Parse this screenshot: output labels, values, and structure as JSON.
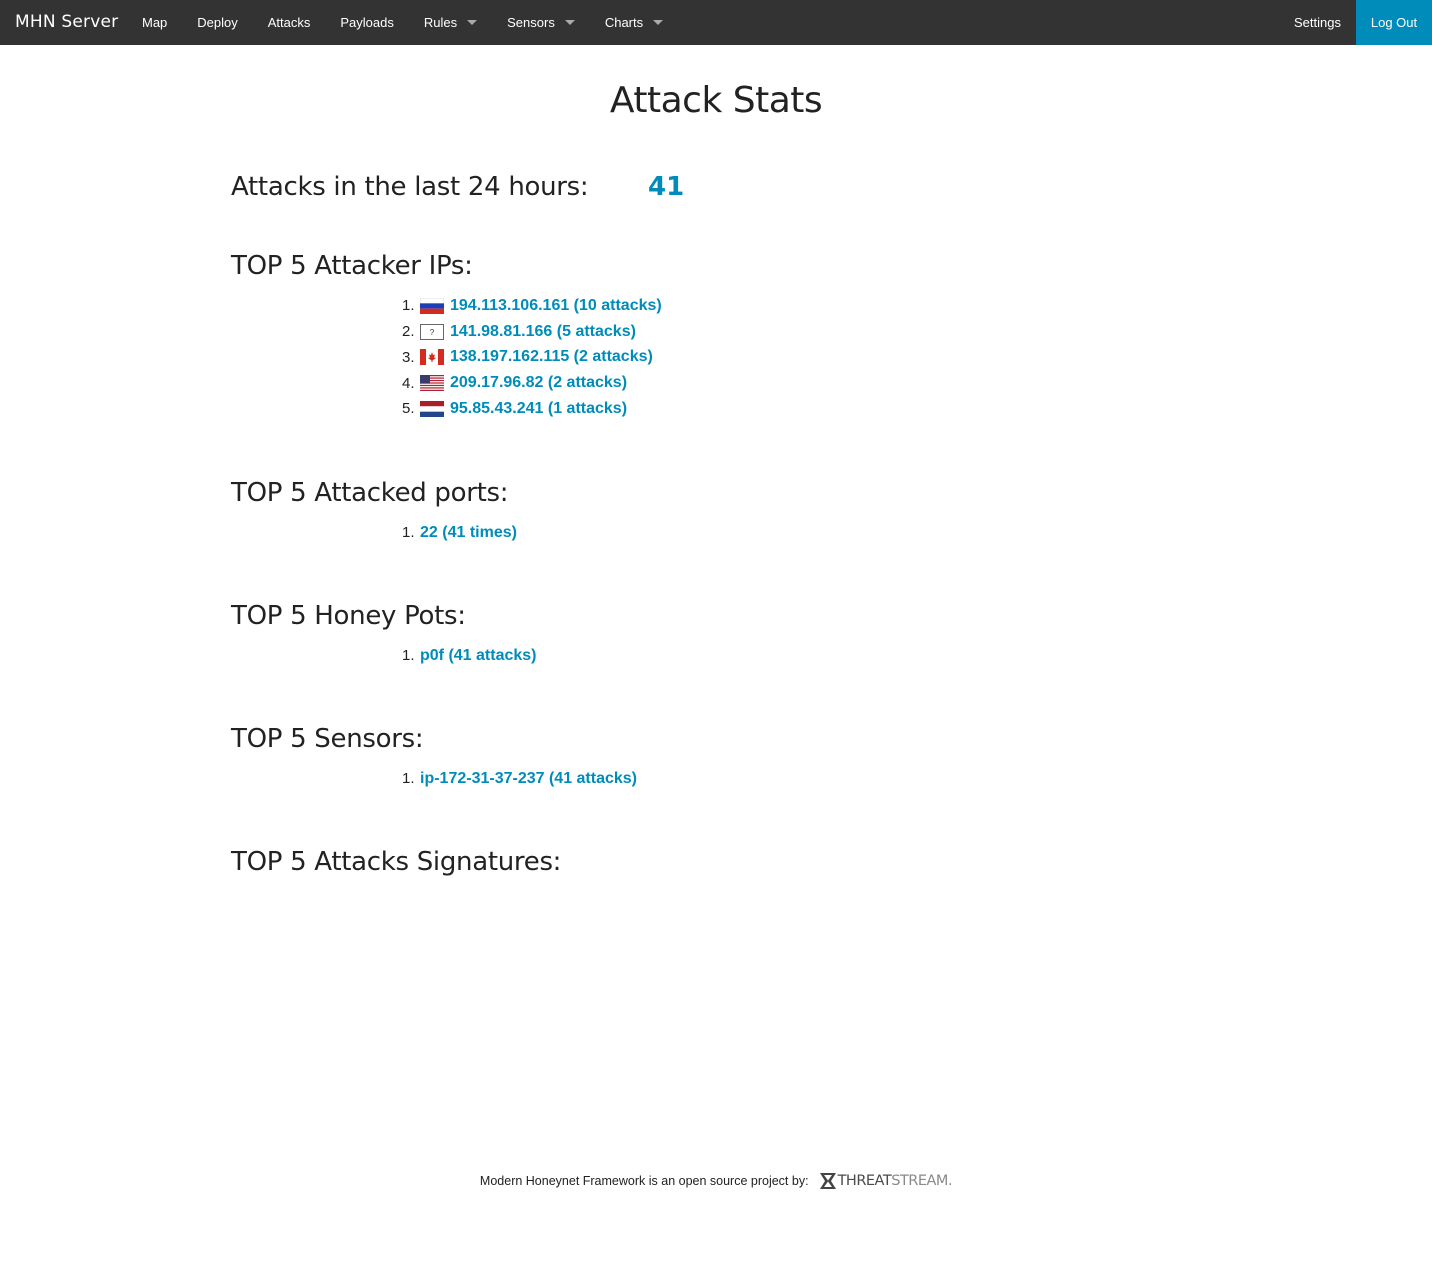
{
  "navbar": {
    "brand": "MHN Server",
    "items": [
      {
        "label": "Map",
        "dropdown": false
      },
      {
        "label": "Deploy",
        "dropdown": false
      },
      {
        "label": "Attacks",
        "dropdown": false
      },
      {
        "label": "Payloads",
        "dropdown": false
      },
      {
        "label": "Rules",
        "dropdown": true
      },
      {
        "label": "Sensors",
        "dropdown": true
      },
      {
        "label": "Charts",
        "dropdown": true
      }
    ],
    "settings": "Settings",
    "logout": "Log Out",
    "accent_color": "#008cba",
    "background_color": "#333333"
  },
  "main": {
    "title": "Attack Stats",
    "attacks_24h": {
      "label": "Attacks in the last 24 hours:",
      "value": "41"
    },
    "top_ips": {
      "heading": "TOP 5 Attacker IPs:",
      "items": [
        {
          "rank": "1.",
          "flag": "russia-flag-icon",
          "text": "194.113.106.161 (10 attacks)"
        },
        {
          "rank": "2.",
          "flag": "unknown-flag-icon",
          "text": "141.98.81.166 (5 attacks)"
        },
        {
          "rank": "3.",
          "flag": "canada-flag-icon",
          "text": "138.197.162.115 (2 attacks)"
        },
        {
          "rank": "4.",
          "flag": "usa-flag-icon",
          "text": "209.17.96.82 (2 attacks)"
        },
        {
          "rank": "5.",
          "flag": "netherlands-flag-icon",
          "text": "95.85.43.241 (1 attacks)"
        }
      ]
    },
    "top_ports": {
      "heading": "TOP 5 Attacked ports:",
      "items": [
        {
          "rank": "1.",
          "text": "22 (41 times)"
        }
      ]
    },
    "top_honeypots": {
      "heading": "TOP 5 Honey Pots:",
      "items": [
        {
          "rank": "1.",
          "text": "p0f (41 attacks)"
        }
      ]
    },
    "top_sensors": {
      "heading": "TOP 5 Sensors:",
      "items": [
        {
          "rank": "1.",
          "text": "ip-172-31-37-237 (41 attacks)"
        }
      ]
    },
    "top_signatures": {
      "heading": "TOP 5 Attacks Signatures:",
      "items": []
    }
  },
  "footer": {
    "text": "Modern Honeynet Framework is an open source project by:",
    "logo_bold": "THREAT",
    "logo_light": "STREAM."
  }
}
